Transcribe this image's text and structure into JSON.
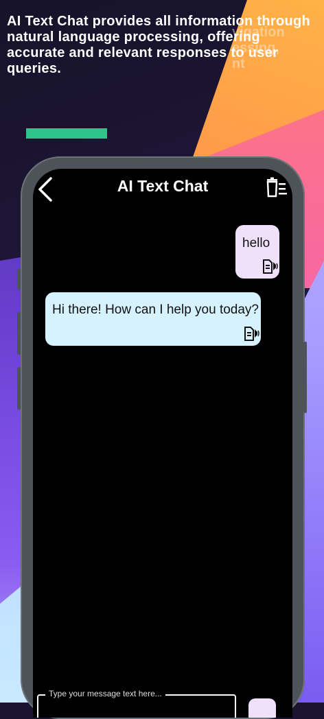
{
  "promo": {
    "headline": "AI Text Chat provides all information through natural language processing, offering accurate and relevant responses to user queries.",
    "ghost_text": "vigation\nessing,\nnt"
  },
  "colors": {
    "accent_bar": "#2ec48a",
    "user_bubble": "#f0e1fb",
    "bot_bubble": "#d6f2ff",
    "screen_bg": "#000000"
  },
  "app": {
    "title": "AI Text Chat",
    "back_icon": "chevron-left-icon",
    "clear_icon": "trash-icon"
  },
  "messages": [
    {
      "role": "user",
      "text": "hello",
      "speak_icon": "speak-icon"
    },
    {
      "role": "bot",
      "text": "Hi there! How can I help you today?",
      "speak_icon": "speak-icon"
    }
  ],
  "composer": {
    "placeholder": "Type your message text here..."
  }
}
